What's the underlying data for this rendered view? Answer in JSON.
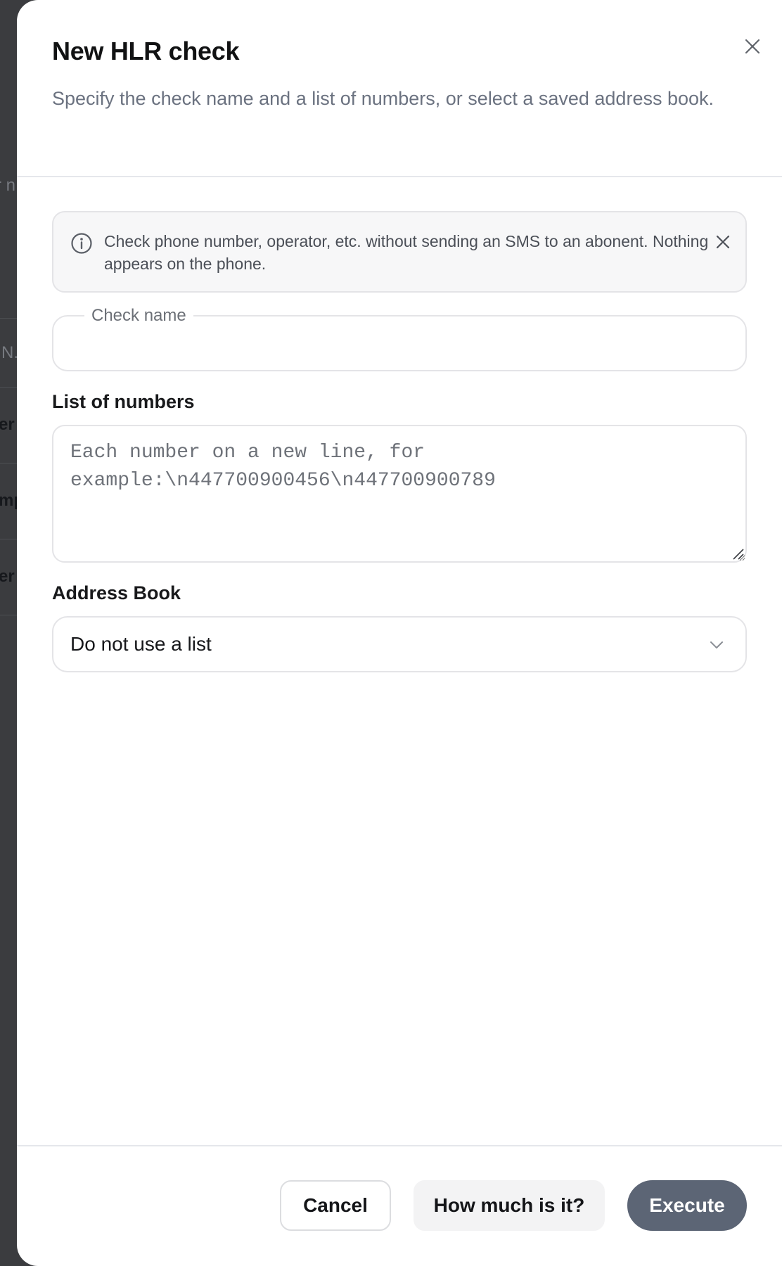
{
  "background": {
    "fragments": [
      {
        "text": "r n"
      },
      {
        "text": "N."
      },
      {
        "text": "er"
      },
      {
        "text": "mp"
      },
      {
        "text": "er"
      }
    ]
  },
  "modal": {
    "title": "New HLR check",
    "subtitle": "Specify the check name and a list of numbers, or select a saved address book.",
    "close_icon": "close-icon",
    "alert": {
      "icon": "info-icon",
      "text": "Check phone number, operator, etc. without sending an SMS to an abonent. Nothing appears on the phone.",
      "close_icon": "close-icon"
    },
    "check_name": {
      "label": "Check name",
      "value": ""
    },
    "numbers": {
      "label": "List of numbers",
      "value": "",
      "placeholder": "Each number on a new line, for example:\\n447700900456\\n447700900789"
    },
    "address_book": {
      "label": "Address Book",
      "selected": "Do not use a list",
      "icon": "chevron-down-icon"
    },
    "footer": {
      "cancel_label": "Cancel",
      "price_label": "How much is it?",
      "execute_label": "Execute"
    }
  },
  "colors": {
    "primary_button": "#5c6575",
    "muted_text": "#6b7280",
    "border": "#e4e4e7",
    "overlay": "#3a3b3e"
  }
}
